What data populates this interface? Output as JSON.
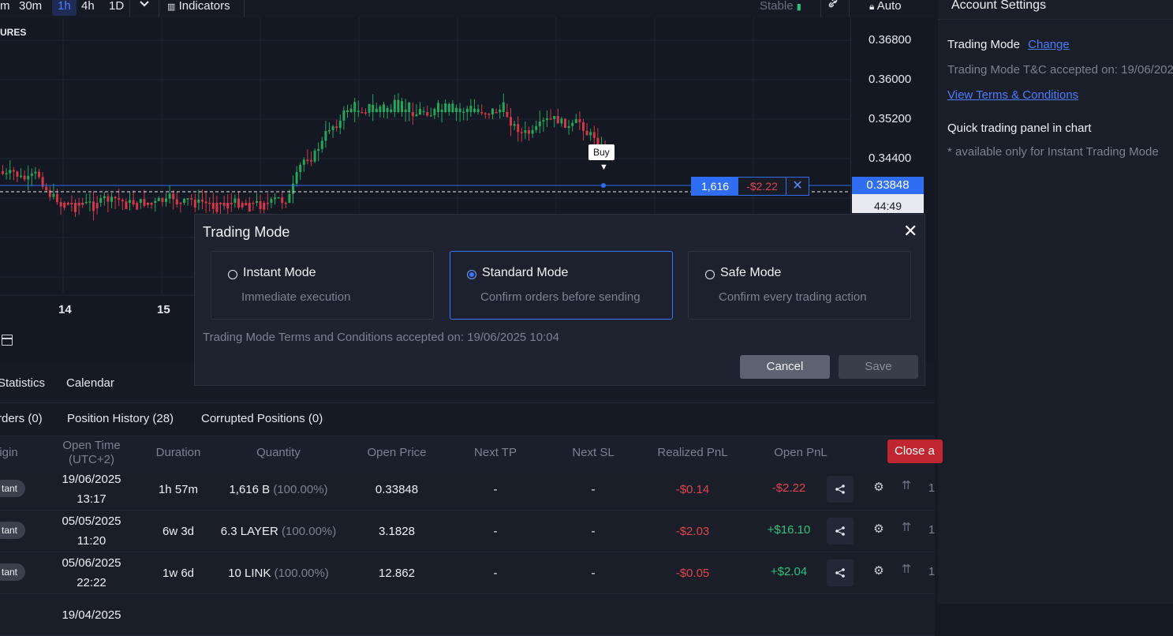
{
  "toolbar": {
    "timeframes": [
      "m",
      "30m",
      "1h",
      "4h",
      "1D"
    ],
    "active_timeframe": "1h",
    "indicators_label": "Indicators",
    "stable_label": "Stable",
    "auto_label": "Auto"
  },
  "chart": {
    "title_fragment": "URES",
    "price_ticks": [
      "0.36800",
      "0.36000",
      "0.35200",
      "0.34400"
    ],
    "current_price": "0.33848",
    "countdown": "44:49",
    "time_ticks": [
      "14",
      "15"
    ],
    "position_qty": "1,616",
    "position_pnl": "-$2.22",
    "position_close_glyph": "✕",
    "buy_marker": "Buy",
    "colors": {
      "up": "#26a65b",
      "down": "#d1394a",
      "price_line": "#2f6df2"
    }
  },
  "right_panel": {
    "title": "Account Settings",
    "trading_mode_label": "Trading Mode",
    "change_link": "Change",
    "tc_accepted": "Trading Mode T&C accepted on: 19/06/2025 10:04",
    "view_terms_link": "View Terms & Conditions",
    "quick_panel_label": "Quick trading panel in chart",
    "quick_panel_note": "* available only for Instant Trading Mode"
  },
  "bottom": {
    "tabs_top": [
      "Statistics",
      "Calendar"
    ],
    "tabs_sub": [
      "rders (0)",
      "Position History (28)",
      "Corrupted Positions (0)"
    ],
    "columns": [
      "igin",
      "Open Time\n(UTC+2)",
      "Duration",
      "Quantity",
      "Open Price",
      "Next TP",
      "Next SL",
      "Realized PnL",
      "Open PnL"
    ],
    "close_all_label": "Close a",
    "rows": [
      {
        "origin": "tant",
        "date": "19/06/2025",
        "time": "13:17",
        "duration": "1h 57m",
        "qty": "1,616",
        "asset": "B",
        "pct": "(100.00%)",
        "open_price": "0.33848",
        "next_tp": "-",
        "next_sl": "-",
        "realized": "-$0.14",
        "open_pnl": "-$2.22",
        "pnl_sign": "neg",
        "extra": "1"
      },
      {
        "origin": "tant",
        "date": "05/05/2025",
        "time": "11:20",
        "duration": "6w 3d",
        "qty": "6.3",
        "asset": "LAYER",
        "pct": "(100.00%)",
        "open_price": "3.1828",
        "next_tp": "-",
        "next_sl": "-",
        "realized": "-$2.03",
        "open_pnl": "+$16.10",
        "pnl_sign": "pos",
        "extra": "1"
      },
      {
        "origin": "tant",
        "date": "05/06/2025",
        "time": "22:22",
        "duration": "1w 6d",
        "qty": "10",
        "asset": "LINK",
        "pct": "(100.00%)",
        "open_price": "12.862",
        "next_tp": "-",
        "next_sl": "-",
        "realized": "-$0.05",
        "open_pnl": "+$2.04",
        "pnl_sign": "pos",
        "extra": "1"
      },
      {
        "origin": "",
        "date": "19/04/2025",
        "time": "",
        "duration": "",
        "qty": "",
        "asset": "",
        "pct": "",
        "open_price": "",
        "next_tp": "",
        "next_sl": "",
        "realized": "",
        "open_pnl": "",
        "pnl_sign": "",
        "extra": ""
      }
    ]
  },
  "modal": {
    "title": "Trading Mode",
    "modes": [
      {
        "name": "Instant Mode",
        "desc": "Immediate execution",
        "selected": false
      },
      {
        "name": "Standard Mode",
        "desc": "Confirm orders before sending",
        "selected": true
      },
      {
        "name": "Safe Mode",
        "desc": "Confirm every trading action",
        "selected": false
      }
    ],
    "tc_text": "Trading Mode Terms and Conditions accepted on: 19/06/2025 10:04",
    "cancel_label": "Cancel",
    "save_label": "Save"
  }
}
